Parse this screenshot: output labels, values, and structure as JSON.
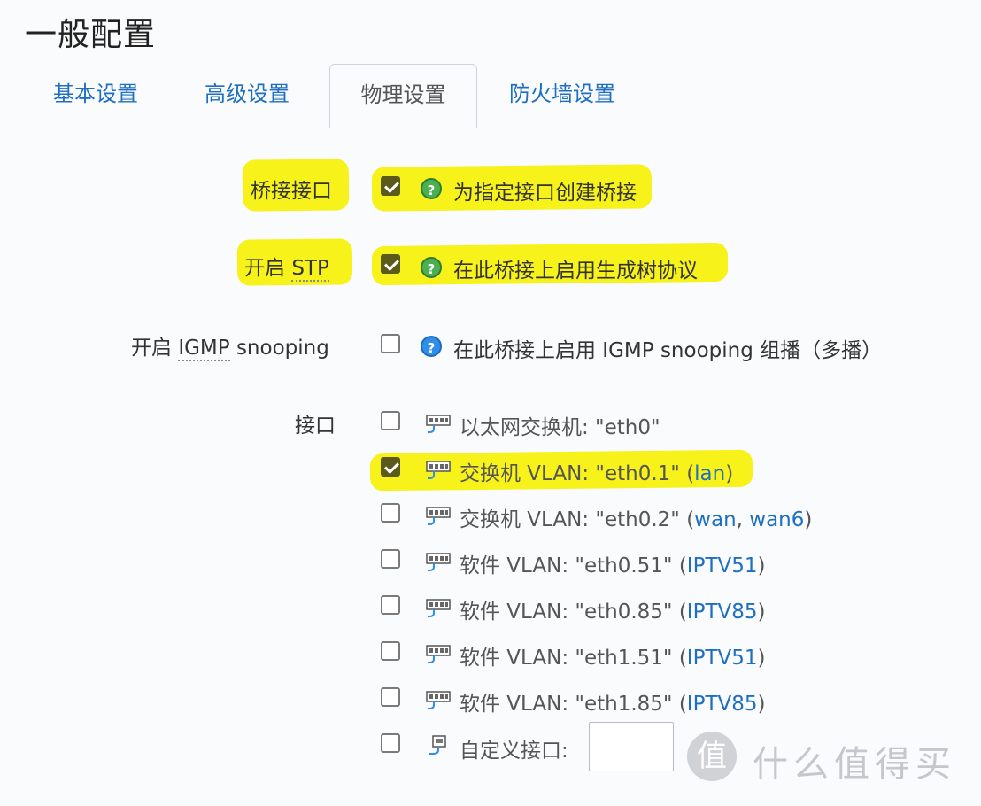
{
  "page": {
    "title": "一般配置"
  },
  "tabs": [
    {
      "label": "基本设置",
      "active": false
    },
    {
      "label": "高级设置",
      "active": false
    },
    {
      "label": "物理设置",
      "active": true
    },
    {
      "label": "防火墙设置",
      "active": false
    }
  ],
  "bridge_interfaces": {
    "label": "桥接接口",
    "checked": true,
    "help": "为指定接口创建桥接"
  },
  "stp": {
    "label_prefix": "开启 ",
    "label_abbr": "STP",
    "checked": true,
    "help": "在此桥接上启用生成树协议"
  },
  "igmp": {
    "label_prefix": "开启 ",
    "label_abbr": "IGMP",
    "label_suffix": " snooping",
    "checked": false,
    "help": "在此桥接上启用 IGMP snooping 组播（多播）"
  },
  "interfaces": {
    "label": "接口",
    "items": [
      {
        "text": "以太网交换机: \"eth0\"",
        "open": "",
        "nets": [],
        "close": "",
        "checked": false
      },
      {
        "text": "交换机 VLAN: \"eth0.1\" ",
        "open": "(",
        "nets": [
          "lan"
        ],
        "close": ")",
        "checked": true
      },
      {
        "text": "交换机 VLAN: \"eth0.2\" ",
        "open": "(",
        "nets": [
          "wan",
          "wan6"
        ],
        "close": ")",
        "checked": false
      },
      {
        "text": "软件 VLAN: \"eth0.51\" ",
        "open": "(",
        "nets": [
          "IPTV51"
        ],
        "close": ")",
        "checked": false
      },
      {
        "text": "软件 VLAN: \"eth0.85\" ",
        "open": "(",
        "nets": [
          "IPTV85"
        ],
        "close": ")",
        "checked": false
      },
      {
        "text": "软件 VLAN: \"eth1.51\" ",
        "open": "(",
        "nets": [
          "IPTV51"
        ],
        "close": ")",
        "checked": false
      },
      {
        "text": "软件 VLAN: \"eth1.85\" ",
        "open": "(",
        "nets": [
          "IPTV85"
        ],
        "close": ")",
        "checked": false
      }
    ],
    "custom": {
      "label": "自定义接口:",
      "value": "",
      "checked": false
    }
  },
  "watermark": {
    "symbol": "值",
    "text": "什么值得买"
  },
  "colors": {
    "highlight": "#f7f21a",
    "link": "#1e6fc1",
    "checkbox_checked": "#5c5a1a",
    "help_green": "#4caf50",
    "help_blue": "#2f8ee8"
  }
}
